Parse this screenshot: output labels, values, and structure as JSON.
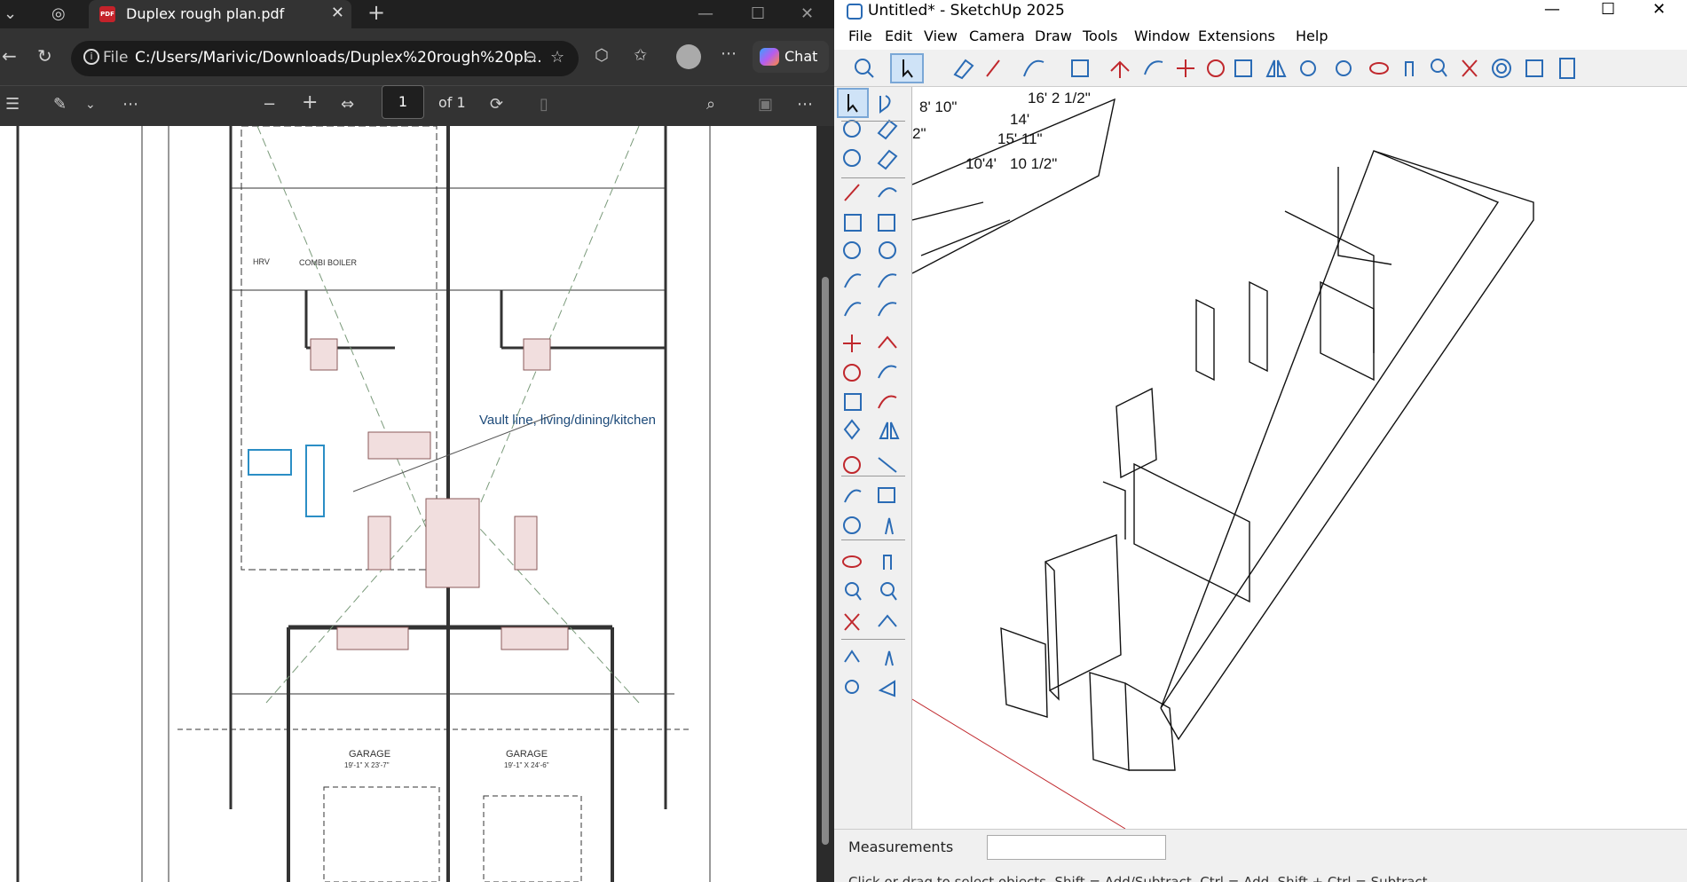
{
  "edge": {
    "tab_title": "Duplex rough plan.pdf",
    "address_prefix": "File",
    "address": "C:/Users/Marivic/Downloads/Duplex%20rough%20pl...",
    "chat_label": "Chat",
    "page_number": "1",
    "page_of": "of 1",
    "plan": {
      "vault_note": "Vault line, living/dining/kitchen",
      "garage_left": "GARAGE",
      "garage_left_dim": "19'-1\" X 23'-7\"",
      "garage_right": "GARAGE",
      "garage_right_dim": "19'-1\" X 24'-6\"",
      "hrv": "HRV",
      "combi": "COMBI BOILER"
    }
  },
  "sketchup": {
    "window_title": "Untitled* - SketchUp 2025",
    "menu": [
      "File",
      "Edit",
      "View",
      "Camera",
      "Draw",
      "Tools",
      "Window",
      "Extensions",
      "Help"
    ],
    "measurements_label": "Measurements",
    "measurements_value": "",
    "status_hint": "Click or drag to select objects. Shift = Add/Subtract. Ctrl = Add. Shift + Ctrl = Subtract.",
    "dims": [
      "8' 10\"",
      "16' 2 1/2\"",
      "14'",
      "2\"",
      "15' 11\"",
      "10'4'",
      "10 1/2\""
    ]
  }
}
